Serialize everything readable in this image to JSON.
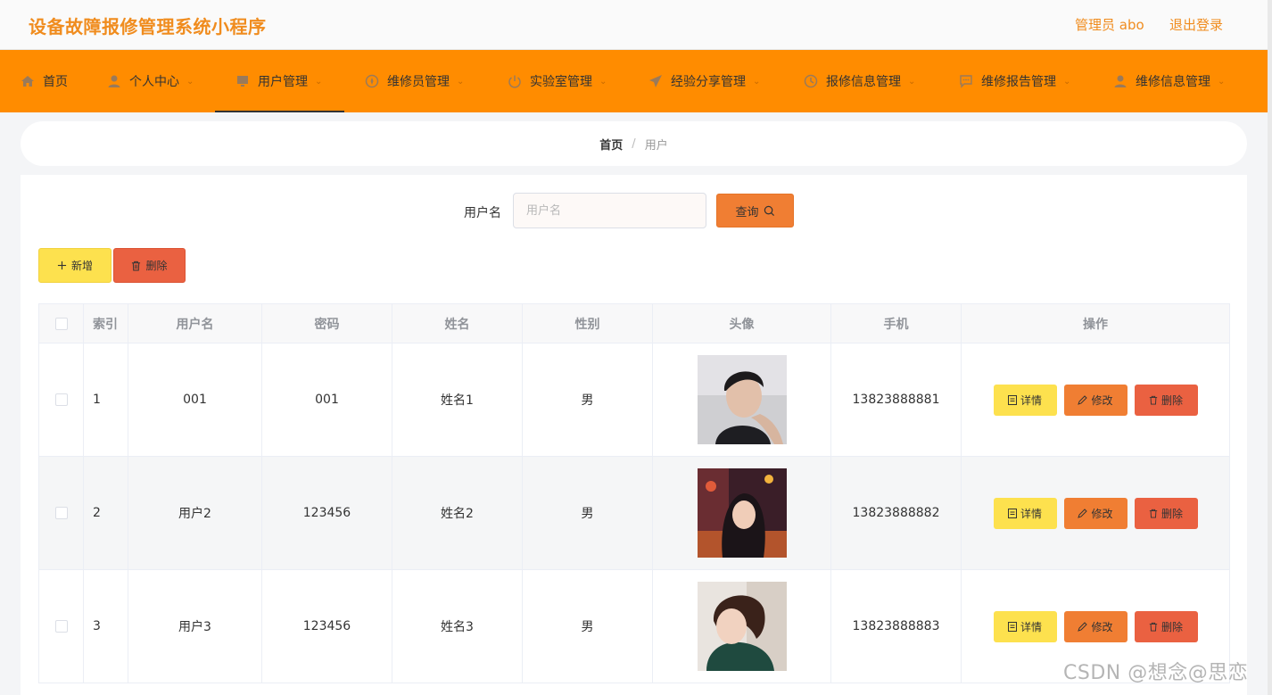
{
  "header": {
    "app_title": "设备故障报修管理系统小程序",
    "admin_label": "管理员 abo",
    "logout_label": "退出登录"
  },
  "nav": {
    "items": [
      {
        "label": "首页",
        "icon": "home-icon",
        "has_dropdown": false,
        "active": false
      },
      {
        "label": "个人中心",
        "icon": "person-icon",
        "has_dropdown": true,
        "active": false
      },
      {
        "label": "用户管理",
        "icon": "monitor-icon",
        "has_dropdown": true,
        "active": true
      },
      {
        "label": "维修员管理",
        "icon": "compass-icon",
        "has_dropdown": true,
        "active": false
      },
      {
        "label": "实验室管理",
        "icon": "power-icon",
        "has_dropdown": true,
        "active": false
      },
      {
        "label": "经验分享管理",
        "icon": "send-icon",
        "has_dropdown": true,
        "active": false
      },
      {
        "label": "报修信息管理",
        "icon": "clock-icon",
        "has_dropdown": true,
        "active": false
      },
      {
        "label": "维修报告管理",
        "icon": "chat-icon",
        "has_dropdown": true,
        "active": false
      },
      {
        "label": "维修信息管理",
        "icon": "user-icon",
        "has_dropdown": true,
        "active": false
      }
    ]
  },
  "breadcrumb": {
    "home": "首页",
    "separator": "/",
    "current": "用户"
  },
  "search": {
    "label": "用户名",
    "placeholder": "用户名",
    "value": "",
    "button_label": "查询"
  },
  "actions": {
    "add_label": "新增",
    "delete_label": "删除"
  },
  "table": {
    "columns": [
      "索引",
      "用户名",
      "密码",
      "姓名",
      "性别",
      "头像",
      "手机",
      "操作"
    ],
    "rows": [
      {
        "index": "1",
        "username": "001",
        "password": "001",
        "name": "姓名1",
        "gender": "男",
        "phone": "13823888881",
        "avatar": "avatar-man"
      },
      {
        "index": "2",
        "username": "用户2",
        "password": "123456",
        "name": "姓名2",
        "gender": "男",
        "phone": "13823888882",
        "avatar": "avatar-woman-night"
      },
      {
        "index": "3",
        "username": "用户3",
        "password": "123456",
        "name": "姓名3",
        "gender": "男",
        "phone": "13823888883",
        "avatar": "avatar-woman-green"
      }
    ],
    "row_actions": {
      "detail_label": "详情",
      "edit_label": "修改",
      "delete_label": "删除"
    }
  },
  "watermark": "CSDN @想念@思恋",
  "colors": {
    "accent_orange": "#ff8c00",
    "title_orange": "#f08c1e",
    "yellow": "#fde14e",
    "orange_button": "#f07e33",
    "red_button": "#ea6141"
  }
}
